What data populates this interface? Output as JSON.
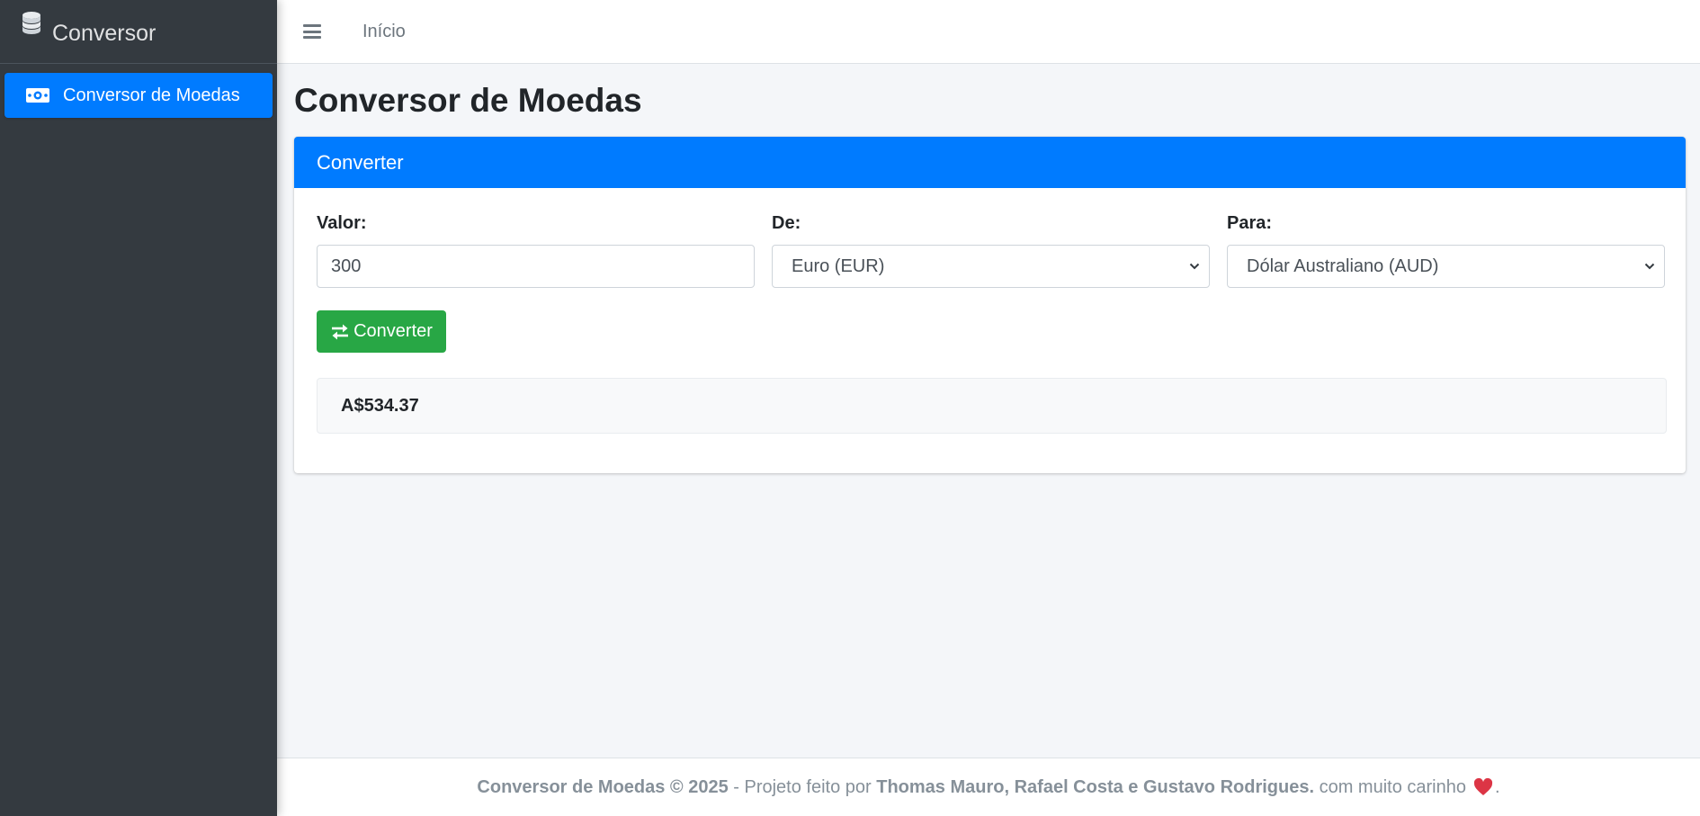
{
  "sidebar": {
    "brand_icon": "coins-icon",
    "brand_text": "Conversor",
    "items": [
      {
        "label": "Conversor de Moedas",
        "icon": "money-bill-icon",
        "active": true
      }
    ]
  },
  "topbar": {
    "menu_icon": "bars-icon",
    "home_link": "Início"
  },
  "page": {
    "title": "Conversor de Moedas"
  },
  "card": {
    "header": "Converter",
    "form": {
      "amount_label": "Valor:",
      "amount_value": "300",
      "from_label": "De:",
      "from_selected": "Euro (EUR)",
      "to_label": "Para:",
      "to_selected": "Dólar Australiano (AUD)",
      "button_label": "Converter",
      "button_icon": "exchange-icon"
    },
    "result": "A$534.37"
  },
  "footer": {
    "brand": "Conversor de Moedas © 2025",
    "middle": " - Projeto feito por ",
    "authors": "Thomas Mauro, Rafael Costa e Gustavo Rodrigues.",
    "suffix": " com muito carinho",
    "end": ".",
    "heart_icon": "heart-icon"
  },
  "colors": {
    "sidebar_bg": "#343a40",
    "primary": "#007bff",
    "success": "#28a745",
    "content_bg": "#f4f6f9",
    "heart": "#dc3545"
  }
}
